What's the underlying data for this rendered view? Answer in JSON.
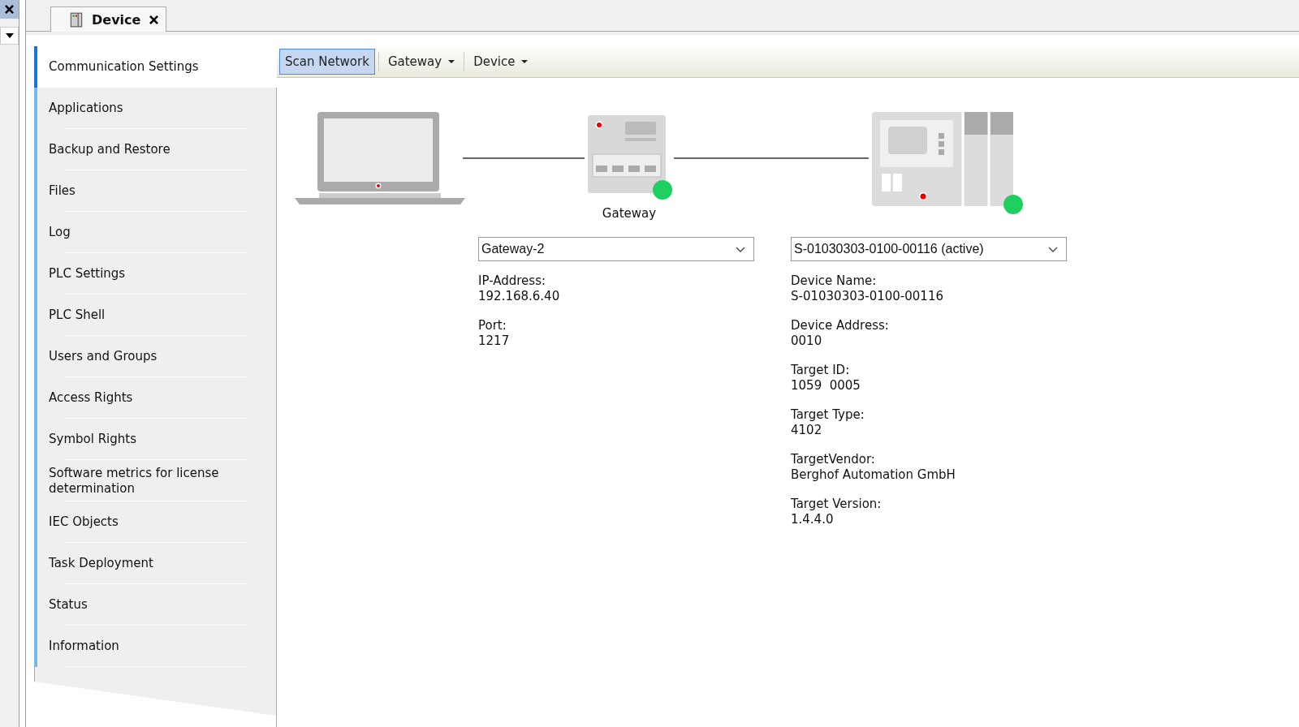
{
  "editor_tab": {
    "title": "Device",
    "selected": true
  },
  "sidebar": {
    "items": [
      {
        "label": "Communication Settings",
        "selected": true
      },
      {
        "label": "Applications",
        "selected": false
      },
      {
        "label": "Backup and Restore",
        "selected": false
      },
      {
        "label": "Files",
        "selected": false
      },
      {
        "label": "Log",
        "selected": false
      },
      {
        "label": "PLC Settings",
        "selected": false
      },
      {
        "label": "PLC Shell",
        "selected": false
      },
      {
        "label": "Users and Groups",
        "selected": false
      },
      {
        "label": "Access Rights",
        "selected": false
      },
      {
        "label": "Symbol Rights",
        "selected": false
      },
      {
        "label": "Software metrics for license determination",
        "selected": false
      },
      {
        "label": "IEC Objects",
        "selected": false
      },
      {
        "label": "Task Deployment",
        "selected": false
      },
      {
        "label": "Status",
        "selected": false
      },
      {
        "label": "Information",
        "selected": false
      }
    ]
  },
  "toolbar": [
    {
      "label": "Scan Network",
      "kind": "button",
      "pressed": true
    },
    {
      "label": "Gateway",
      "kind": "dropdown",
      "pressed": false
    },
    {
      "label": "Device",
      "kind": "dropdown",
      "pressed": false
    }
  ],
  "gateway": {
    "caption": "Gateway",
    "online": true,
    "selection": "Gateway-2",
    "fields": [
      {
        "label": "IP-Address:",
        "value": "192.168.6.40"
      },
      {
        "label": "Port:",
        "value": "1217"
      }
    ]
  },
  "device": {
    "online": true,
    "selection": "S-01030303-0100-00116 (active)",
    "fields": [
      {
        "label": "Device Name:",
        "value": "S-01030303-0100-00116"
      },
      {
        "label": "Device Address:",
        "value": "0010"
      },
      {
        "label": "Target ID:",
        "value": "1059  0005"
      },
      {
        "label": "Target Type:",
        "value": "4102"
      },
      {
        "label": "TargetVendor:",
        "value": "Berghof Automation GmbH"
      },
      {
        "label": "Target Version:",
        "value": "1.4.4.0"
      }
    ]
  }
}
